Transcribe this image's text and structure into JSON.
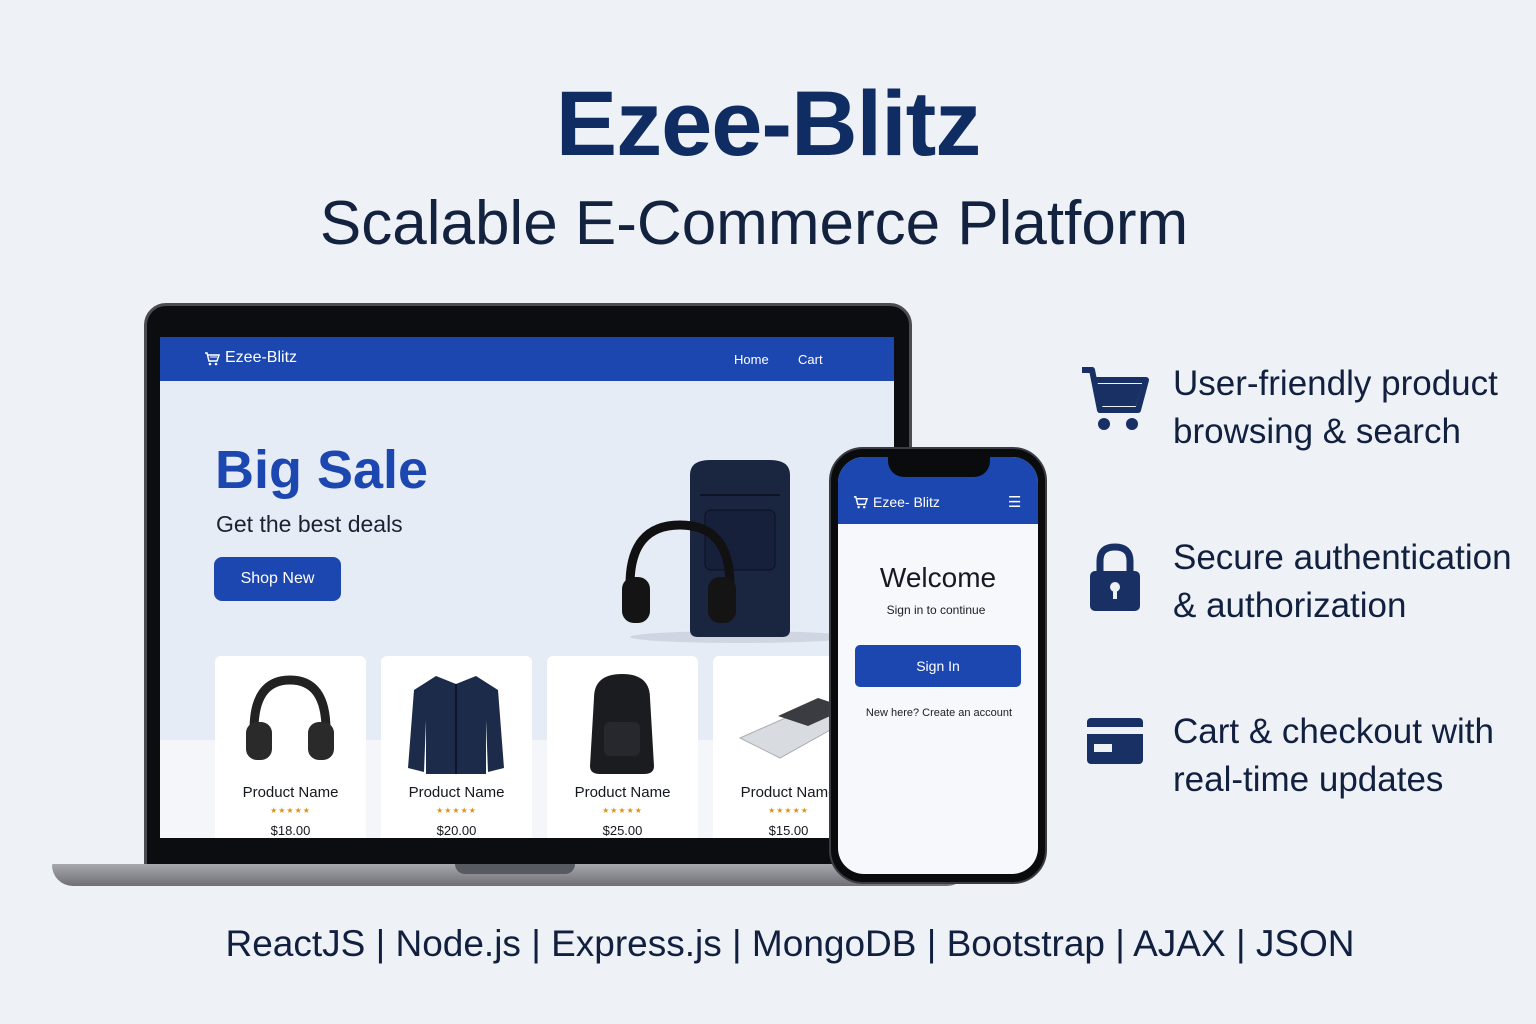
{
  "header": {
    "title": "Ezee-Blitz",
    "subtitle": "Scalable E-Commerce Platform"
  },
  "laptop": {
    "navbar": {
      "brand": "Ezee-Blitz",
      "links": [
        "Home",
        "Cart"
      ]
    },
    "hero": {
      "heading": "Big Sale",
      "tagline": "Get the best deals",
      "cta": "Shop New"
    },
    "products": [
      {
        "name": "Product Name",
        "rating": "★★★★★",
        "price": "$18.00",
        "icon": "headphones-icon"
      },
      {
        "name": "Product Name",
        "rating": "★★★★★",
        "price": "$20.00",
        "icon": "jacket-icon"
      },
      {
        "name": "Product Name",
        "rating": "★★★★★",
        "price": "$25.00",
        "icon": "backpack-icon"
      },
      {
        "name": "Product Name",
        "rating": "★★★★★",
        "price": "$15.00",
        "icon": "trackpad-icon"
      }
    ]
  },
  "phone": {
    "navbar": {
      "brand": "Ezee- Blitz",
      "menu_icon": "☰"
    },
    "login": {
      "heading": "Welcome",
      "subheading": "Sign in to continue",
      "button": "Sign In",
      "register_link": "New here? Create an account"
    }
  },
  "features": [
    {
      "icon": "shopping-cart-icon",
      "text": "User-friendly product browsing & search"
    },
    {
      "icon": "padlock-icon",
      "text": "Secure authentication & authorization"
    },
    {
      "icon": "credit-card-icon",
      "text": "Cart & checkout with real-time updates"
    }
  ],
  "tech_stack": "ReactJS | Node.js | Express.js | MongoDB | Bootstrap | AJAX | JSON",
  "colors": {
    "primary": "#1c47b0",
    "dark_text": "#102d63",
    "background": "#eef1f6",
    "star": "#d8951d"
  }
}
